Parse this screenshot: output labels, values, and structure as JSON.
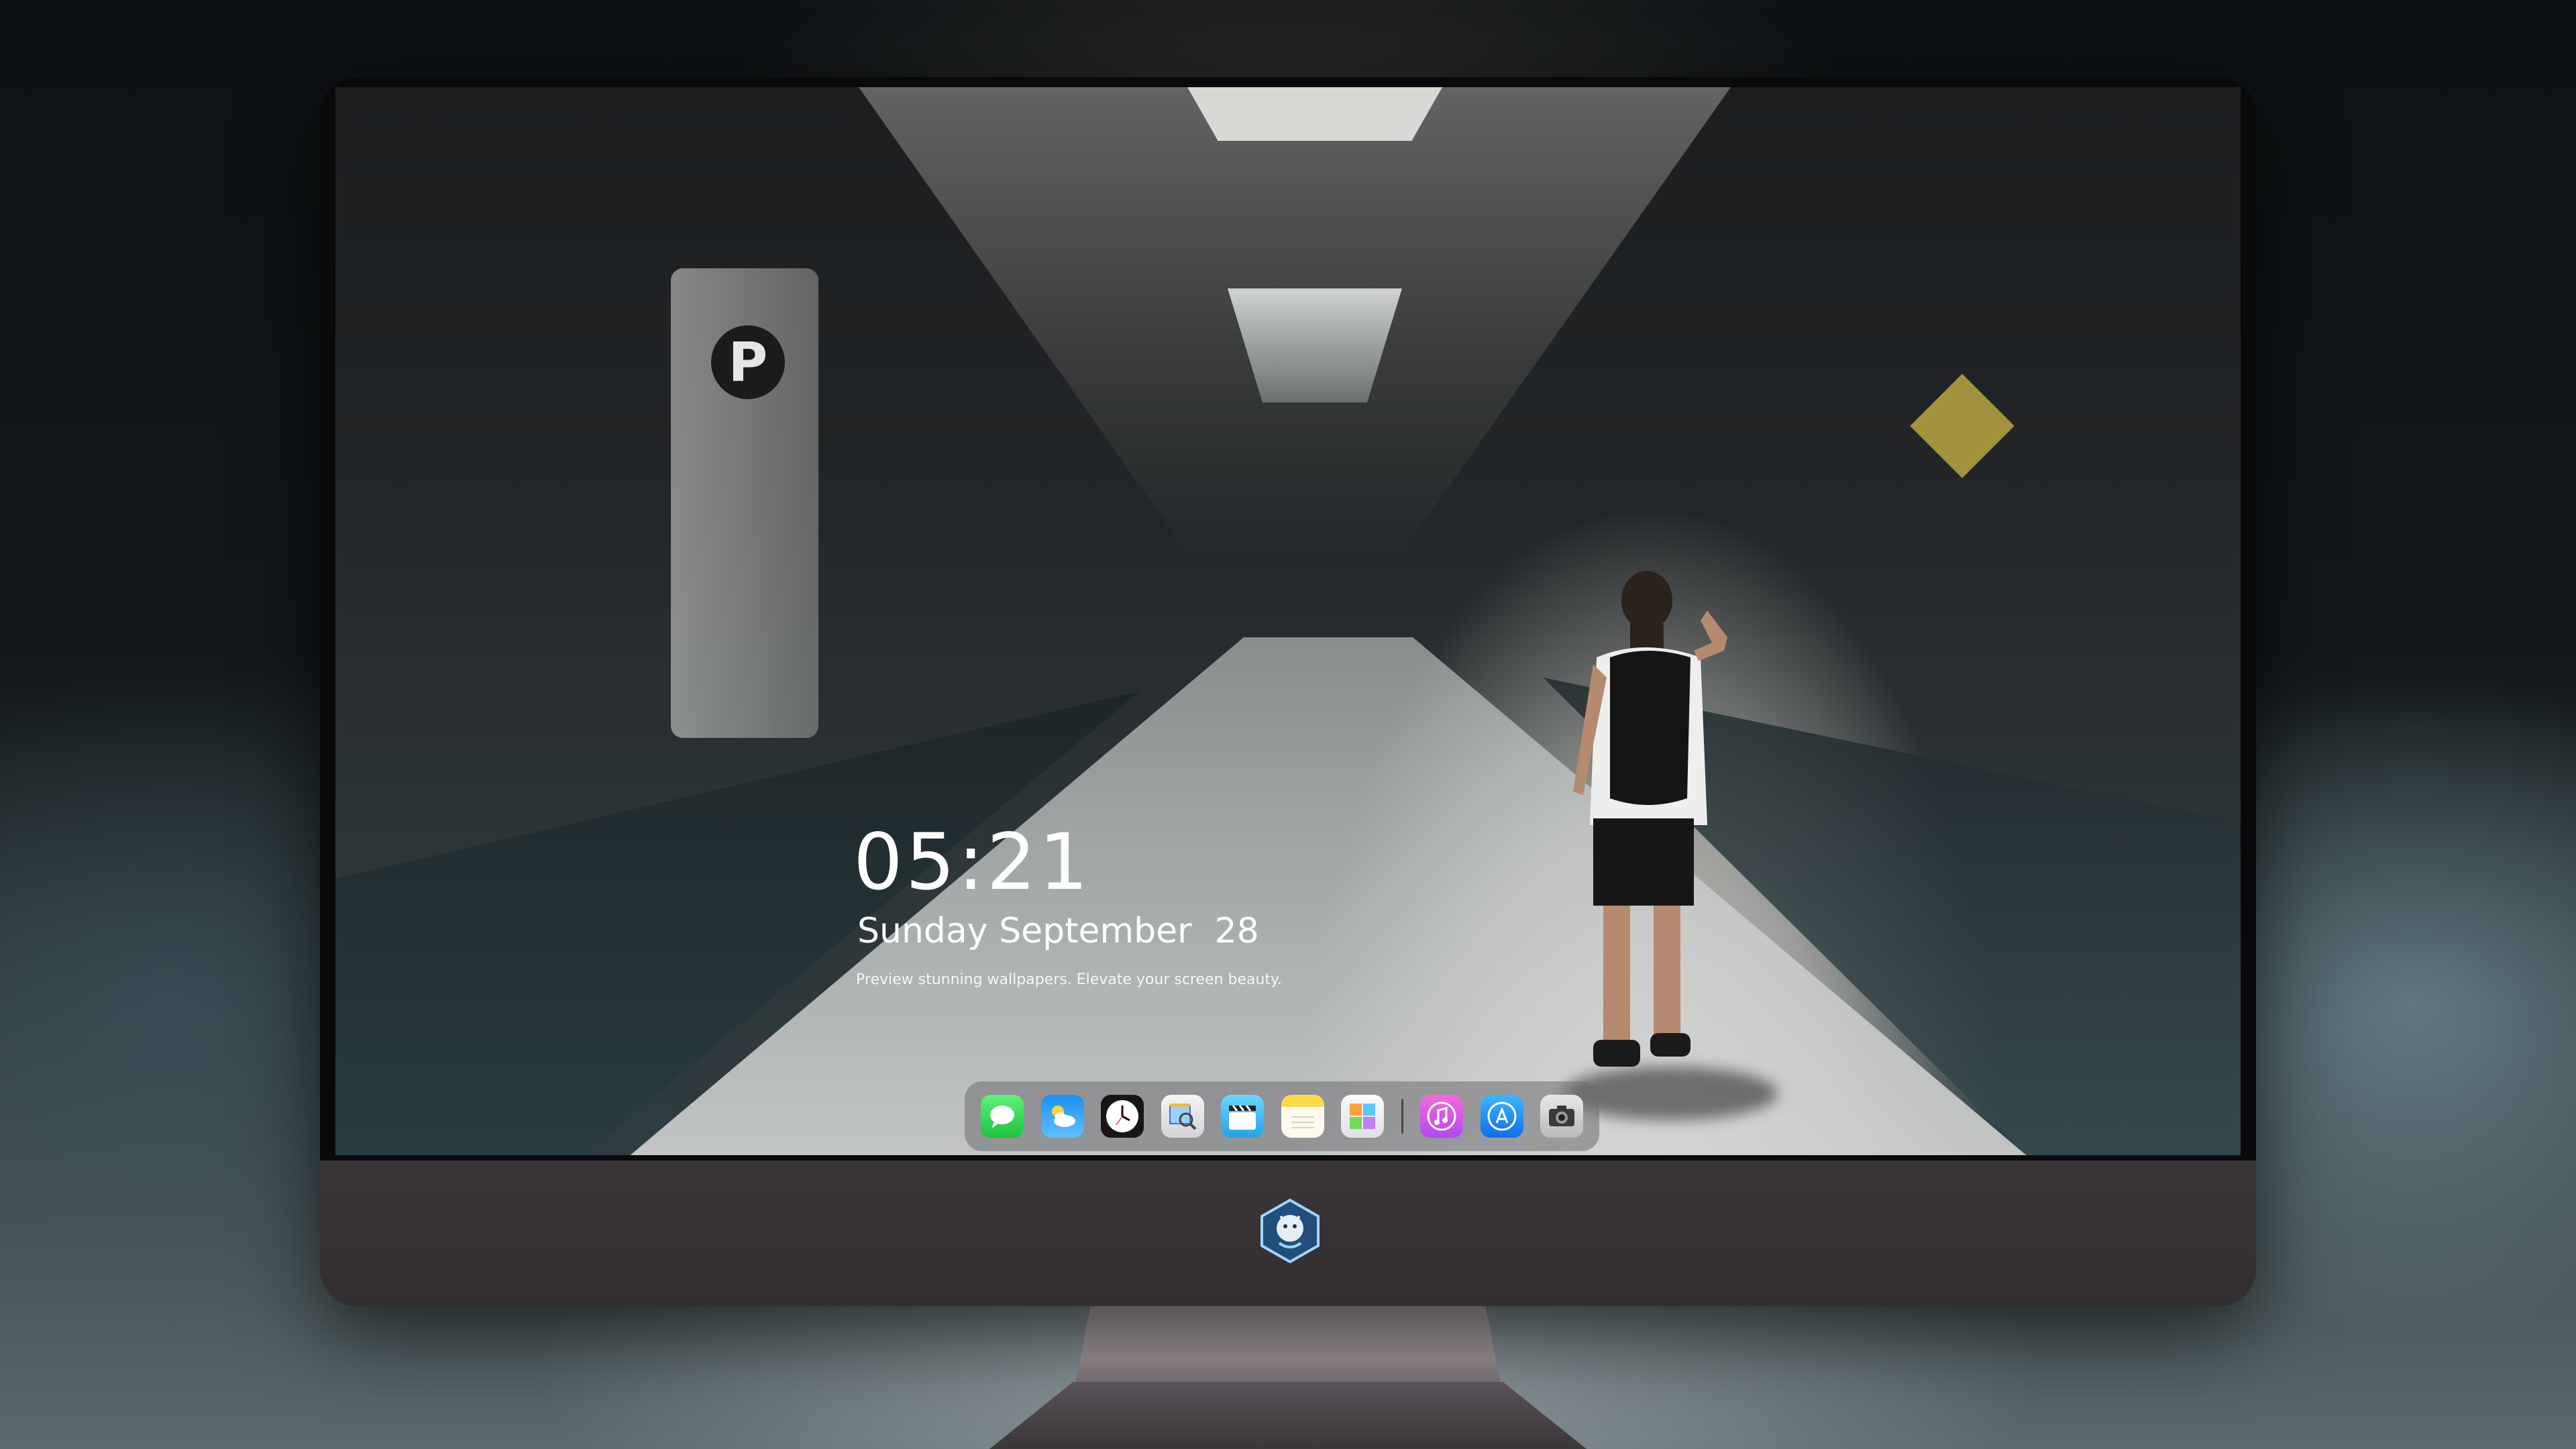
{
  "lock_screen": {
    "time": "05:21",
    "weekday_month": "Sunday September",
    "day": "28",
    "tagline": "Preview stunning wallpapers. Elevate your screen beauty."
  },
  "wallpaper": {
    "pillar_letter": "P"
  },
  "dock": {
    "apps": [
      {
        "name": "Messages",
        "icon": "messages-icon"
      },
      {
        "name": "Weather",
        "icon": "weather-icon"
      },
      {
        "name": "Clock",
        "icon": "clock-icon"
      },
      {
        "name": "Preview",
        "icon": "preview-icon"
      },
      {
        "name": "Clips",
        "icon": "clapperboard-icon"
      },
      {
        "name": "Notes",
        "icon": "notes-icon"
      },
      {
        "name": "Photos",
        "icon": "photos-icon"
      },
      {
        "name": "iTunes",
        "icon": "music-note-icon"
      },
      {
        "name": "App Store",
        "icon": "app-store-icon"
      },
      {
        "name": "Camera",
        "icon": "camera-icon"
      }
    ]
  },
  "colors": {
    "chin": "#3a3638",
    "dock_bg": "#6e6e73",
    "text": "#ffffff"
  }
}
